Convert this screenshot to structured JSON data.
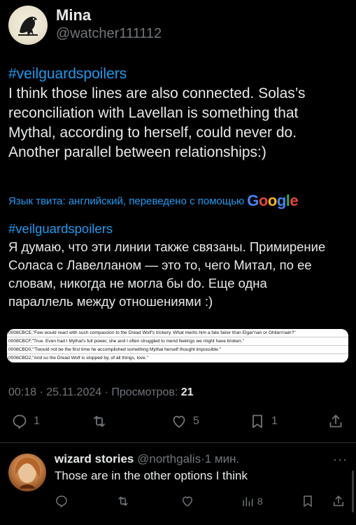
{
  "author": {
    "display_name": "Mina",
    "handle": "@watcher111112"
  },
  "tweet": {
    "hashtag": "#veilguardspoilers",
    "lines": [
      "I think those lines are also connected. Solas’s",
      "reconciliation with Lavellan is something that",
      "Mythal, according to herself, could never do.",
      "Another parallel between relationships:)"
    ]
  },
  "translation": {
    "notice": "Язык твита: английский, переведено с помощью",
    "provider": "Google",
    "hashtag": "#veilguardspoilers",
    "lines": [
      "Я думаю, что эти линии также связаны. Примирение",
      "Соласа с Лавелланом — это то, чего Митал, по ее",
      "словам, никогда не могла бы do. Еще одна",
      "параллель между отношениями :)"
    ]
  },
  "attached_image": {
    "rows": [
      "0008CBCE,\"Few would react with such compassion to the Dread Wolf's trickery. What merits him a fate fairer than Elgar'nan or Ghilan'nain?\"",
      "0008CBCF,\"True. Even had I Mythal's full power, she and I often struggled to mend feelings we might have broken.\"",
      "0008CBD0,\"'Twould not be the first time he accomplished something Mythal herself thought impossible.\"",
      "0008CBD2,\"And so the Dread Wolf is stopped by, of all things, love.\""
    ]
  },
  "meta": {
    "time_date": "00:18 · 25.11.2024 · ",
    "views_label": "Просмотров: ",
    "views_count": "21"
  },
  "actions": {
    "replies": "1",
    "retweets": "",
    "likes": "5",
    "bookmarks": "1"
  },
  "reply": {
    "name": "wizard stories",
    "handle": "@northgalis",
    "time": "·1 мин.",
    "text": "Those are in the other options I think",
    "more": "···",
    "views": "8"
  },
  "colors": {
    "background": "#000000",
    "text": "#e7e9ea",
    "secondary": "#71767b",
    "accent": "#1d9bf0"
  }
}
